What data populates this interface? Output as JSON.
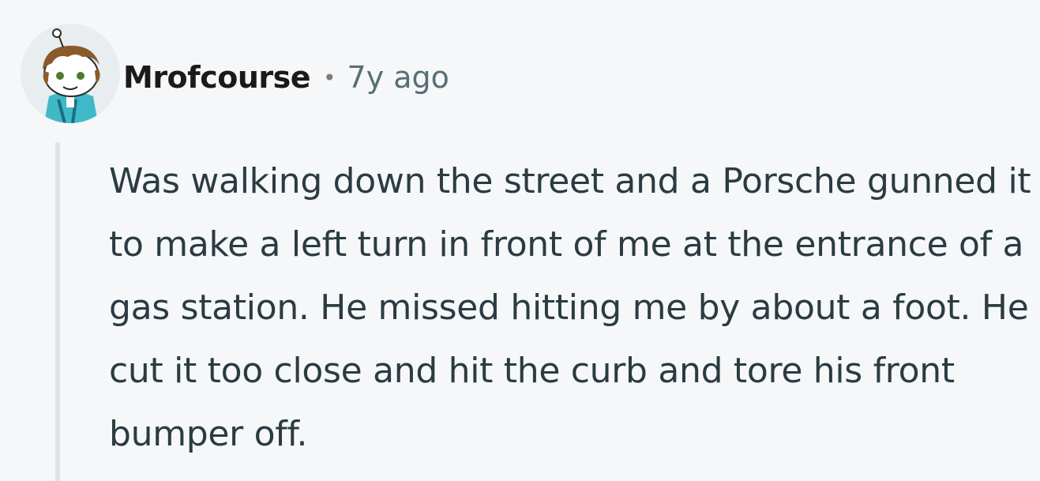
{
  "comment": {
    "author": "Mrofcourse",
    "separator": "•",
    "age": "7y ago",
    "body": "Was walking down the street and a Porsche gunned it to make a left turn in front of me at the entrance of a gas station. He missed hitting me by about a foot. He cut it too close and hit the curb and tore his front bumper off.",
    "avatar_icon": "snoo-avatar-icon"
  },
  "colors": {
    "background": "#f6f7f8",
    "author": "#1a1a1b",
    "age": "#576f76",
    "body": "#2a3c42",
    "thread_line": "#dfe3e6"
  }
}
